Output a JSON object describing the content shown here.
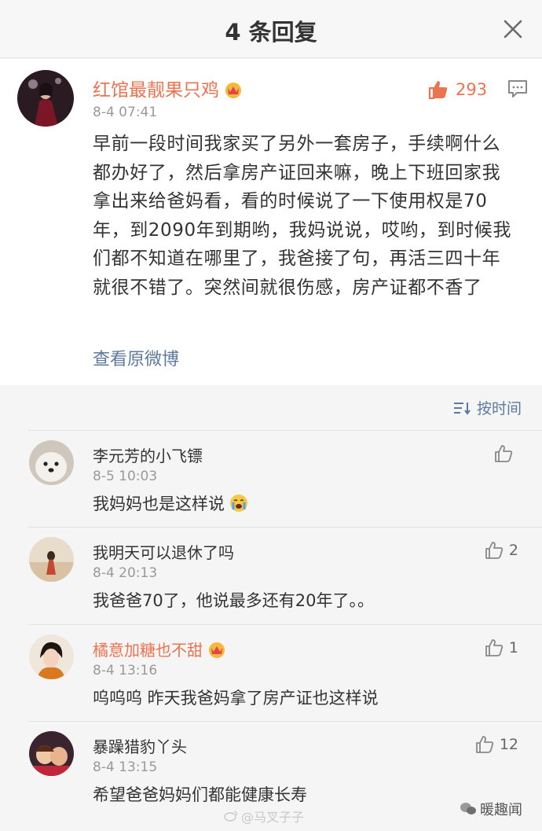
{
  "header": {
    "title": "4 条回复",
    "close_icon": "close-icon"
  },
  "post": {
    "author": "红馆最靓果只鸡",
    "time": "8-4 07:41",
    "like_count": "293",
    "text": "早前一段时间我家买了另外一套房子，手续啊什么都办好了，然后拿房产证回来嘛，晚上下班回家我拿出来给爸妈看，看的时候说了一下使用权是70年，到2090年到期哟，我妈说说，哎哟，到时候我们都不知道在哪里了，我爸接了句，再活三四十年就很不错了。突然间就很伤感，房产证都不香了",
    "view_original": "查看原微博",
    "accent_color": "#eb7350",
    "link_color": "#5d7a9c"
  },
  "sort": {
    "label": "按时间",
    "icon": "sort-icon"
  },
  "replies": [
    {
      "name": "李元芳的小飞镖",
      "time": "8-5 10:03",
      "text": "我妈妈也是这样说",
      "likes": "",
      "vip": false,
      "emoji": "crying-face"
    },
    {
      "name": "我明天可以退休了吗",
      "time": "8-4 20:13",
      "text": "我爸爸70了，他说最多还有20年了。。",
      "likes": "2",
      "vip": false
    },
    {
      "name": "橘意加糖也不甜",
      "time": "8-4 13:16",
      "text": "呜呜呜 昨天我爸妈拿了房产证也这样说",
      "likes": "1",
      "vip": true
    },
    {
      "name": "暴躁猎豹丫头",
      "time": "8-4 13:15",
      "text": "希望爸爸妈妈们都能健康长寿",
      "likes": "12",
      "vip": false
    }
  ],
  "watermark": {
    "center": "@马叉子子",
    "right": "暖趣闻"
  }
}
